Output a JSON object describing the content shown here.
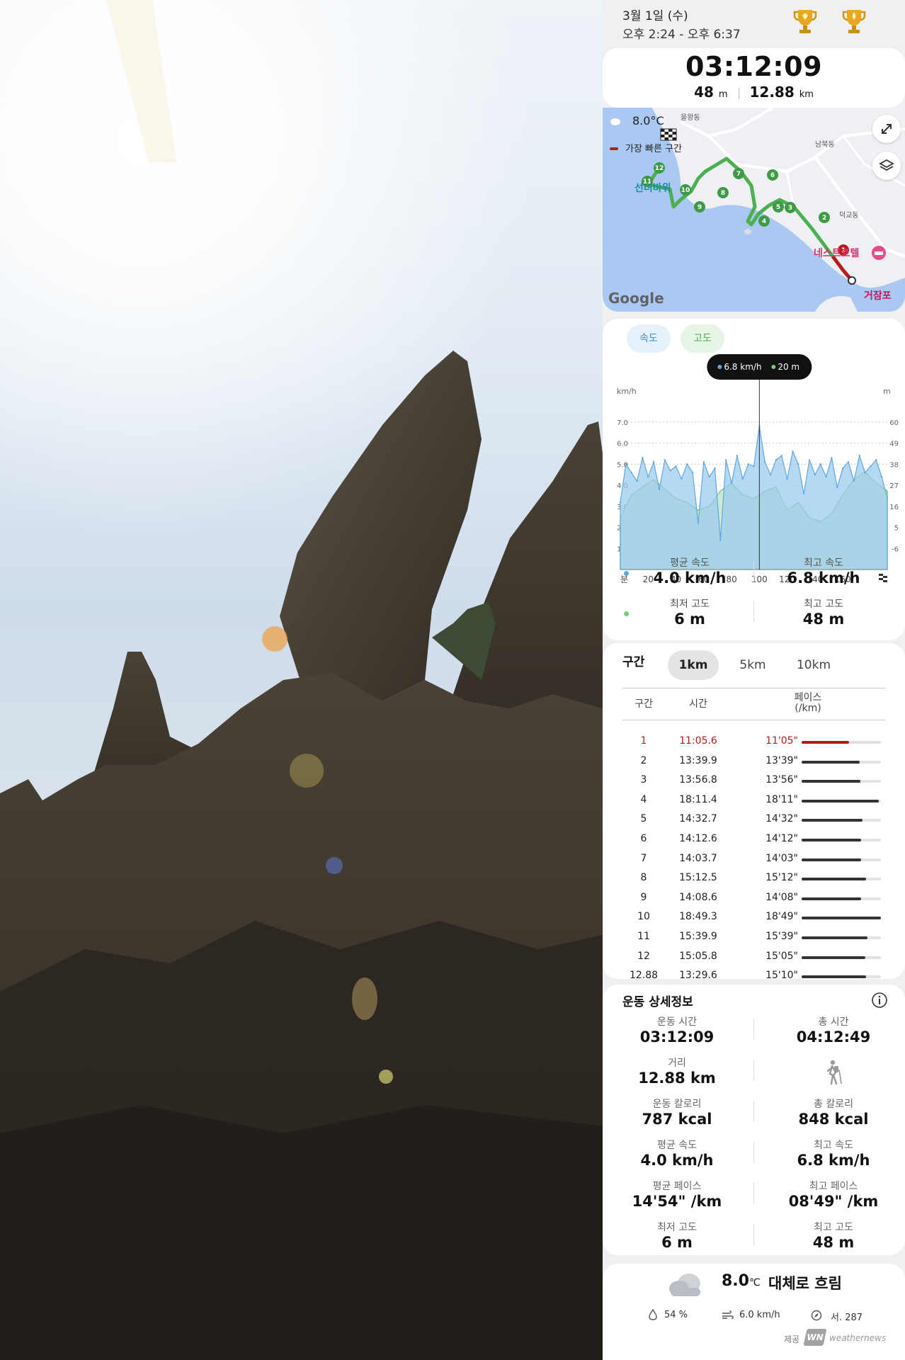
{
  "header": {
    "date": "3월 1일 (수)",
    "time_range": "오후 2:24 - 오후 6:37",
    "trophies": [
      "trophy-icon",
      "trophy-icon"
    ]
  },
  "summary": {
    "duration": "03:12:09",
    "elevation_value": "48",
    "elevation_unit": "m",
    "distance_value": "12.88",
    "distance_unit": "km"
  },
  "map": {
    "temperature": "8.0°C",
    "legend_label": "가장 빠른 구간",
    "places": [
      "을왕동",
      "남북동",
      "덕교동",
      "선녀바위",
      "네스트호텔",
      "거잠포"
    ],
    "attribution": "Google",
    "markers": [
      "1",
      "2",
      "3",
      "4",
      "5",
      "6",
      "7",
      "8",
      "9",
      "10",
      "11",
      "12"
    ]
  },
  "chart_tabs": {
    "speed": "속도",
    "altitude": "고도"
  },
  "chart_data": {
    "type": "area",
    "tooltip": {
      "speed": "6.8 km/h",
      "altitude": "20 m"
    },
    "left_axis_label": "km/h",
    "right_axis_label": "m",
    "left_ticks": [
      "7.0",
      "6.0",
      "5.0",
      "4.0",
      "3.0",
      "2.0",
      "1.0"
    ],
    "right_ticks": [
      "60",
      "49",
      "38",
      "27",
      "16",
      "5",
      "-6"
    ],
    "x_axis_label": "분",
    "x_ticks": [
      "20",
      "40",
      "60",
      "80",
      "100",
      "120",
      "140",
      "160"
    ],
    "xlim": [
      0,
      192
    ],
    "ylim_speed": [
      0,
      8
    ],
    "ylim_altitude": [
      -17,
      71
    ],
    "series": [
      {
        "name": "속도",
        "color": "#5fa8e0",
        "x": [
          0,
          4,
          8,
          12,
          16,
          20,
          24,
          28,
          32,
          36,
          40,
          44,
          48,
          52,
          56,
          60,
          64,
          68,
          72,
          76,
          80,
          84,
          88,
          92,
          96,
          100,
          104,
          108,
          112,
          116,
          120,
          124,
          128,
          132,
          136,
          140,
          144,
          148,
          152,
          156,
          160,
          164,
          168,
          172,
          176,
          180,
          184,
          188,
          192
        ],
        "values": [
          3.2,
          5.0,
          4.6,
          4.2,
          5.3,
          4.4,
          5.1,
          3.8,
          5.2,
          4.7,
          4.9,
          4.3,
          5.0,
          4.6,
          2.2,
          5.1,
          4.4,
          4.8,
          1.4,
          5.2,
          4.1,
          5.4,
          4.3,
          5.0,
          4.9,
          6.8,
          5.1,
          4.5,
          5.2,
          5.4,
          4.3,
          5.6,
          5.0,
          3.6,
          5.2,
          4.5,
          5.0,
          4.4,
          5.3,
          3.9,
          4.8,
          5.1,
          4.2,
          5.4,
          4.6,
          4.9,
          5.2,
          4.4,
          3.4
        ]
      },
      {
        "name": "고도",
        "color": "#7ccb7a",
        "x": [
          0,
          8,
          16,
          24,
          32,
          40,
          48,
          56,
          64,
          72,
          80,
          88,
          96,
          104,
          112,
          120,
          128,
          136,
          144,
          152,
          160,
          168,
          176,
          184,
          192
        ],
        "values": [
          10,
          22,
          26,
          30,
          25,
          20,
          18,
          14,
          16,
          24,
          28,
          22,
          20,
          24,
          26,
          14,
          18,
          10,
          8,
          12,
          22,
          30,
          34,
          28,
          24
        ]
      }
    ]
  },
  "chart_stats": {
    "avg_speed_label": "평균 속도",
    "avg_speed": "4.0 km/h",
    "max_speed_label": "최고 속도",
    "max_speed": "6.8 km/h",
    "min_alt_label": "최저 고도",
    "min_alt": "6 m",
    "max_alt_label": "최고 고도",
    "max_alt": "48 m"
  },
  "segments": {
    "title": "구간",
    "tabs": [
      "1km",
      "5km",
      "10km"
    ],
    "col_segment": "구간",
    "col_time": "시간",
    "col_pace_1": "페이스",
    "col_pace_2": "(/km)",
    "rows": [
      {
        "seg": "1",
        "time": "11:05.6",
        "pace": "11'05\"",
        "frac": 0.6,
        "highlight": true
      },
      {
        "seg": "2",
        "time": "13:39.9",
        "pace": "13'39\"",
        "frac": 0.73
      },
      {
        "seg": "3",
        "time": "13:56.8",
        "pace": "13'56\"",
        "frac": 0.74
      },
      {
        "seg": "4",
        "time": "18:11.4",
        "pace": "18'11\"",
        "frac": 0.97
      },
      {
        "seg": "5",
        "time": "14:32.7",
        "pace": "14'32\"",
        "frac": 0.77
      },
      {
        "seg": "6",
        "time": "14:12.6",
        "pace": "14'12\"",
        "frac": 0.75
      },
      {
        "seg": "7",
        "time": "14:03.7",
        "pace": "14'03\"",
        "frac": 0.75
      },
      {
        "seg": "8",
        "time": "15:12.5",
        "pace": "15'12\"",
        "frac": 0.81
      },
      {
        "seg": "9",
        "time": "14:08.6",
        "pace": "14'08\"",
        "frac": 0.75
      },
      {
        "seg": "10",
        "time": "18:49.3",
        "pace": "18'49\"",
        "frac": 1.0
      },
      {
        "seg": "11",
        "time": "15:39.9",
        "pace": "15'39\"",
        "frac": 0.83
      },
      {
        "seg": "12",
        "time": "15:05.8",
        "pace": "15'05\"",
        "frac": 0.8
      },
      {
        "seg": "12.88",
        "time": "13:29.6",
        "pace": "15'10\"",
        "frac": 0.81
      }
    ]
  },
  "details": {
    "title": "운동 상세정보",
    "workout_time_label": "운동 시간",
    "workout_time": "03:12:09",
    "total_time_label": "총 시간",
    "total_time": "04:12:49",
    "distance_label": "거리",
    "distance": "12.88 km",
    "workout_cal_label": "운동 칼로리",
    "workout_cal": "787 kcal",
    "total_cal_label": "총 칼로리",
    "total_cal": "848 kcal",
    "avg_speed_label": "평균 속도",
    "avg_speed": "4.0 km/h",
    "max_speed_label": "최고 속도",
    "max_speed": "6.8 km/h",
    "avg_pace_label": "평균 페이스",
    "avg_pace": "14'54\" /km",
    "max_pace_label": "최고 페이스",
    "max_pace": "08'49\" /km",
    "min_alt_label": "최저 고도",
    "min_alt": "6 m",
    "max_alt_label": "최고 고도",
    "max_alt": "48 m"
  },
  "weather": {
    "temp_value": "8.0",
    "temp_unit": "℃",
    "condition": "대체로 흐림",
    "humidity": "54 %",
    "wind": "6.0 km/h",
    "direction": "서. 287",
    "provider_label": "제공",
    "provider_name": "weathernews"
  },
  "colors": {
    "route": "#4caf50",
    "highlight": "#b71c1c",
    "speed": "#5fa8e0",
    "altitude": "#7ccb7a"
  }
}
